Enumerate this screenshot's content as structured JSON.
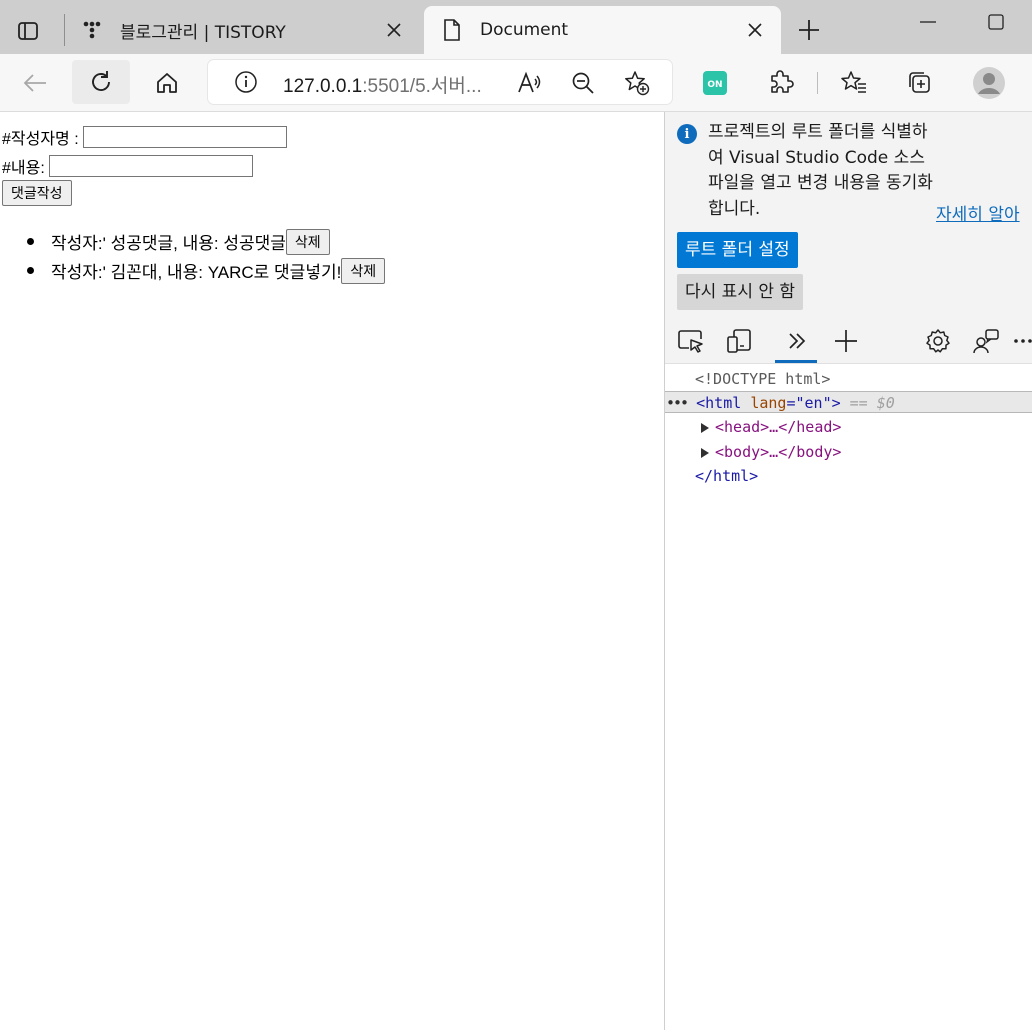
{
  "tabs": {
    "inactive_title": "블로그관리 | TISTORY",
    "active_title": "Document"
  },
  "address": {
    "host": "127.0.0.1",
    "path": ":5501/5.서버..."
  },
  "page": {
    "author_label": "#작성자명 :",
    "content_label": "#내용:",
    "author_value": "",
    "content_value": "",
    "submit_label": "댓글작성",
    "comments": [
      {
        "text": "작성자:' 성공댓글, 내용: 성공댓글",
        "delete_label": "삭제"
      },
      {
        "text": "작성자:' 김꼰대, 내용: YARC로 댓글넣기!",
        "delete_label": "삭제"
      }
    ]
  },
  "devtools": {
    "info_text": "프로젝트의 루트 폴더를 식별하여 Visual Studio Code 소스 파일을 열고 변경 내용을 동기화합니다.",
    "learn_more": "자세히 알아",
    "primary_button": "루트 폴더 설정",
    "secondary_button": "다시 표시 안 함",
    "dom": {
      "doctype": "<!DOCTYPE html>",
      "html_open_tag": "<html",
      "html_attr": "lang",
      "html_attr_eq": "=\"",
      "html_attr_value": "en",
      "html_close_bracket": "\">",
      "selected_marker": "== $0",
      "dots": "•••",
      "head": "<head>…</head>",
      "body": "<body>…</body>",
      "html_close": "</html>"
    }
  },
  "colors": {
    "accent": "#0078d4",
    "link": "#0f6cbd"
  }
}
